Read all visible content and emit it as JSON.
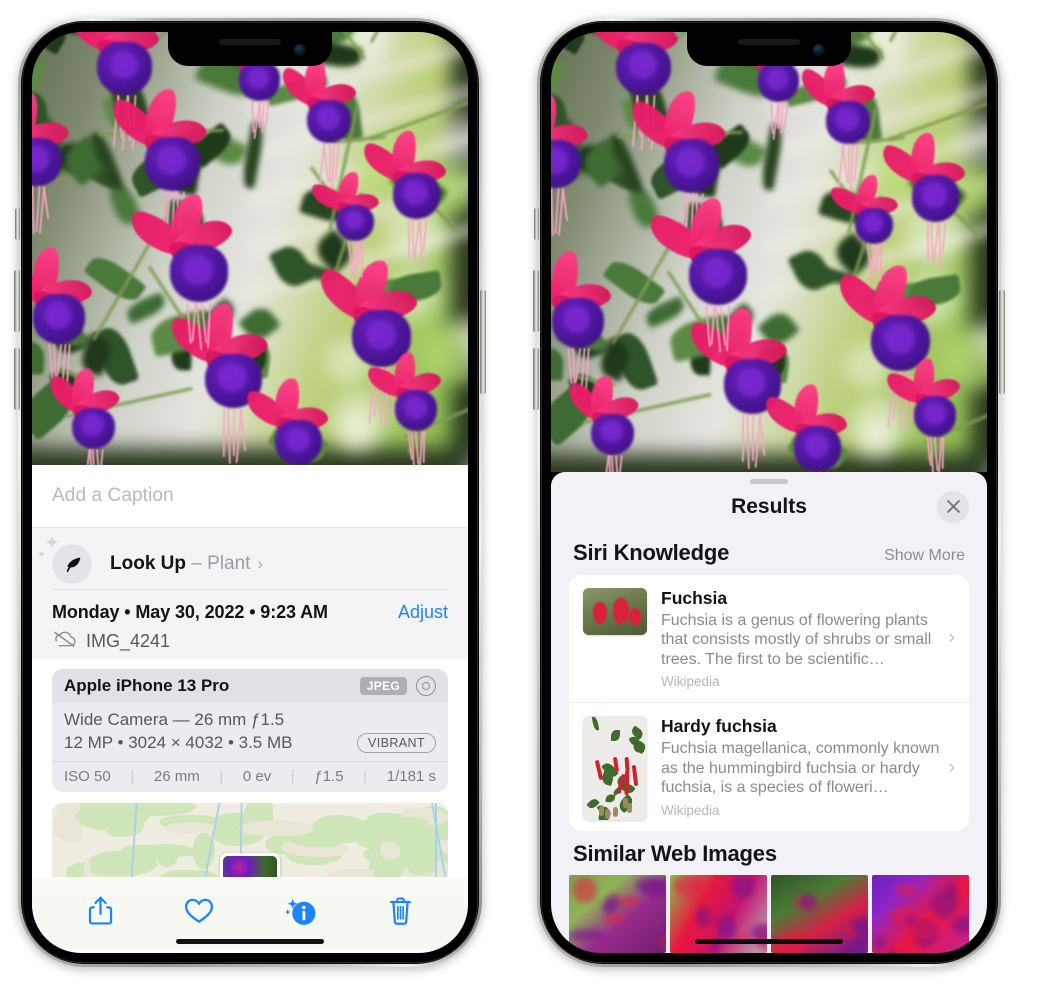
{
  "left_phone": {
    "name": "photos-info-screen",
    "caption_placeholder": "Add a Caption",
    "lookup": {
      "label": "Look Up",
      "separator": "–",
      "subject": "Plant",
      "chevron": "›",
      "icon": "leaf-icon"
    },
    "meta": {
      "date": "Monday • May 30, 2022 • 9:23 AM",
      "adjust_label": "Adjust",
      "filename": "IMG_4241",
      "cloud_icon": "cloud-slash-icon"
    },
    "exif": {
      "device": "Apple iPhone 13 Pro",
      "format_badge": "JPEG",
      "aperture_icon": "aperture-icon",
      "lens_line": "Wide Camera — 26 mm ƒ1.5",
      "specs_line": "12 MP • 3024 × 4032 • 3.5 MB",
      "style_badge": "VIBRANT",
      "settings": [
        "ISO 50",
        "26 mm",
        "0 ev",
        "ƒ1.5",
        "1/181 s"
      ]
    },
    "toolbar": [
      {
        "name": "share-button",
        "icon": "share-icon"
      },
      {
        "name": "favorite-button",
        "icon": "heart-icon"
      },
      {
        "name": "info-button",
        "icon": "info-sparkle-icon"
      },
      {
        "name": "delete-button",
        "icon": "trash-icon"
      }
    ]
  },
  "right_phone": {
    "name": "visual-lookup-results-screen",
    "leaf_marker": "leaf-marker-icon",
    "sheet": {
      "title": "Results",
      "close_icon": "close-icon"
    },
    "siri_knowledge": {
      "heading": "Siri Knowledge",
      "show_more": "Show More",
      "items": [
        {
          "title": "Fuchsia",
          "description": "Fuchsia is a genus of flowering plants that consists mostly of shrubs or small trees. The first to be scientific…",
          "source": "Wikipedia",
          "chevron": "›"
        },
        {
          "title": "Hardy fuchsia",
          "description": "Fuchsia magellanica, commonly known as the hummingbird fuchsia or hardy fuchsia, is a species of floweri…",
          "source": "Wikipedia",
          "chevron": "›"
        }
      ]
    },
    "similar_web_images": {
      "heading": "Similar Web Images",
      "count": 4
    }
  },
  "colors": {
    "accent_blue": "#1b84ff",
    "sheet_gray": "#f2f2f6",
    "card_white": "#ffffff",
    "secondary_text": "#8a8a90"
  }
}
